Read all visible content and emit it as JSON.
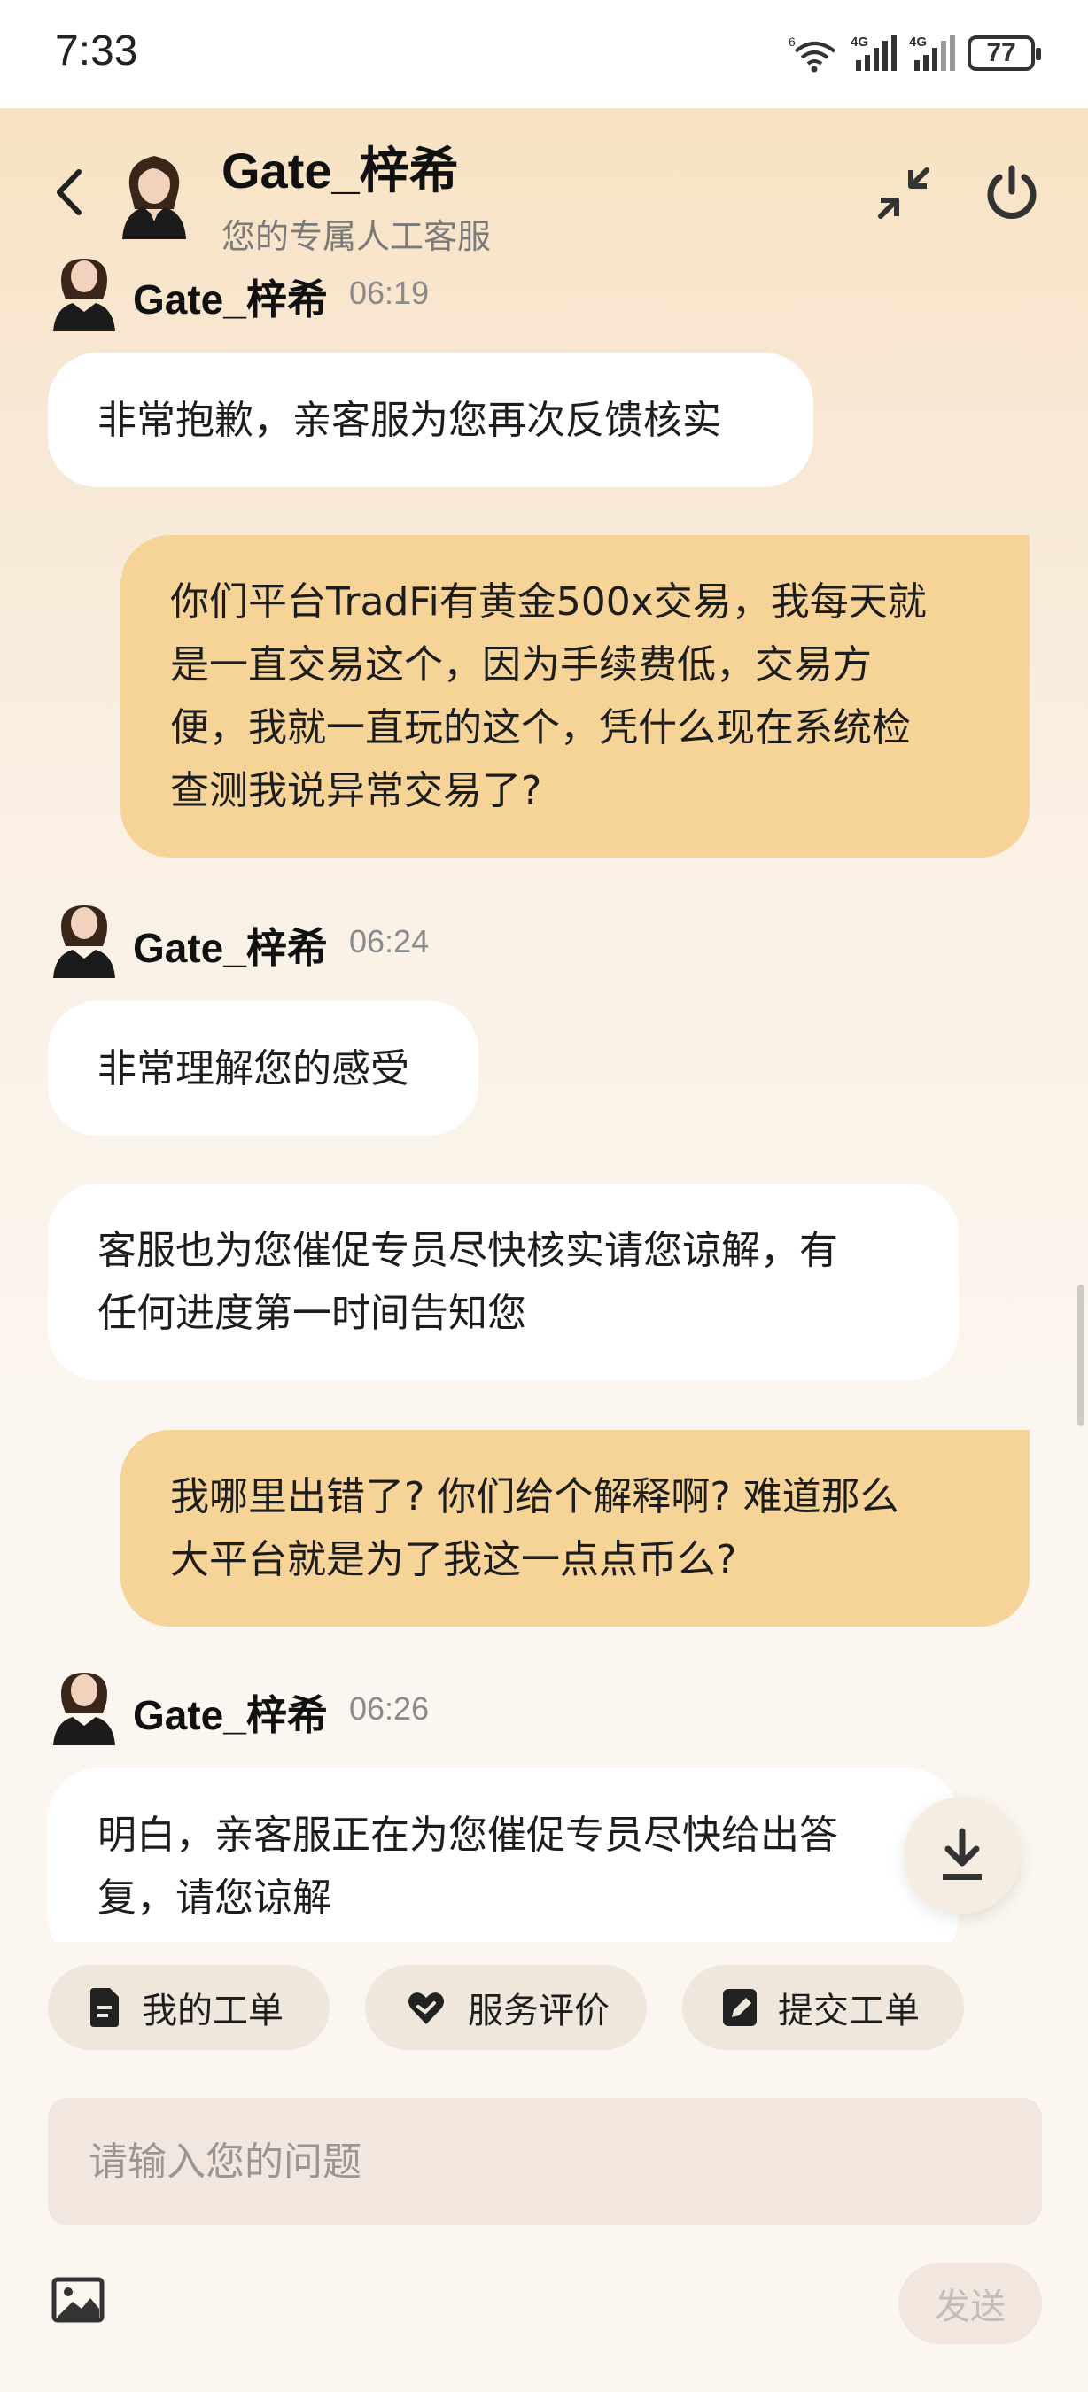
{
  "status_bar": {
    "time": "7:33",
    "wifi_label": "6",
    "signal1_label": "4G",
    "signal2_label": "4G",
    "battery": "77"
  },
  "header": {
    "title": "Gate_梓希",
    "subtitle": "您的专属人工客服"
  },
  "messages": [
    {
      "type": "agent_header",
      "name": "Gate_梓希",
      "time": "06:19"
    },
    {
      "type": "in",
      "lines": [
        "非常抱歉，亲客服为您再次反馈核实"
      ]
    },
    {
      "type": "out",
      "lines": [
        "你们平台TradFi有黄金500x交易，我每天就",
        "是一直交易这个，因为手续费低，交易方",
        "便，我就一直玩的这个，凭什么现在系统检",
        "查测我说异常交易了?"
      ]
    },
    {
      "type": "agent_header",
      "name": "Gate_梓希",
      "time": "06:24"
    },
    {
      "type": "in",
      "lines": [
        "非常理解您的感受"
      ]
    },
    {
      "type": "in",
      "lines": [
        "客服也为您催促专员尽快核实请您谅解，有",
        "任何进度第一时间告知您"
      ]
    },
    {
      "type": "out",
      "lines": [
        "我哪里出错了? 你们给个解释啊? 难道那么",
        "大平台就是为了我这一点点币么?"
      ]
    },
    {
      "type": "agent_header",
      "name": "Gate_梓希",
      "time": "06:26"
    },
    {
      "type": "in",
      "lines": [
        "明白，亲客服正在为您催促专员尽快给出答",
        "复，请您谅解"
      ]
    }
  ],
  "quick_actions": [
    {
      "label": "我的工单",
      "icon": "document-icon"
    },
    {
      "label": "服务评价",
      "icon": "heart-hand-icon"
    },
    {
      "label": "提交工单",
      "icon": "edit-document-icon"
    }
  ],
  "input": {
    "placeholder": "请输入您的问题",
    "value": ""
  },
  "send_label": "发送",
  "colors": {
    "accent_bubble": "#f6d396",
    "incoming_bubble": "#ffffff",
    "chip_bg": "#efe6dc",
    "input_bg": "#f1e7de"
  }
}
